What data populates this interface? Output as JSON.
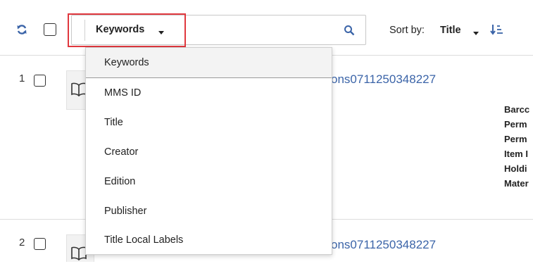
{
  "toolbar": {
    "search_type": "Keywords",
    "search_value": "",
    "sort_label": "Sort by:",
    "sort_value": "Title"
  },
  "menu": {
    "items": [
      {
        "label": "Keywords",
        "selected": true
      },
      {
        "label": "MMS ID"
      },
      {
        "label": "Title"
      },
      {
        "label": "Creator"
      },
      {
        "label": "Edition"
      },
      {
        "label": "Publisher"
      },
      {
        "label": "Title Local Labels"
      }
    ]
  },
  "results": [
    {
      "number": "1",
      "title_fragment": "ons0711250348227",
      "meta_labels": [
        "Barcc",
        "Perm",
        "Perm",
        "Item I",
        "Holdi",
        "Mater"
      ]
    },
    {
      "number": "2",
      "title_fragment": "ons0711250348227"
    }
  ],
  "colors": {
    "accent": "#3b64a8",
    "highlight_border": "#e0383e",
    "divider": "#dcdcdc"
  }
}
